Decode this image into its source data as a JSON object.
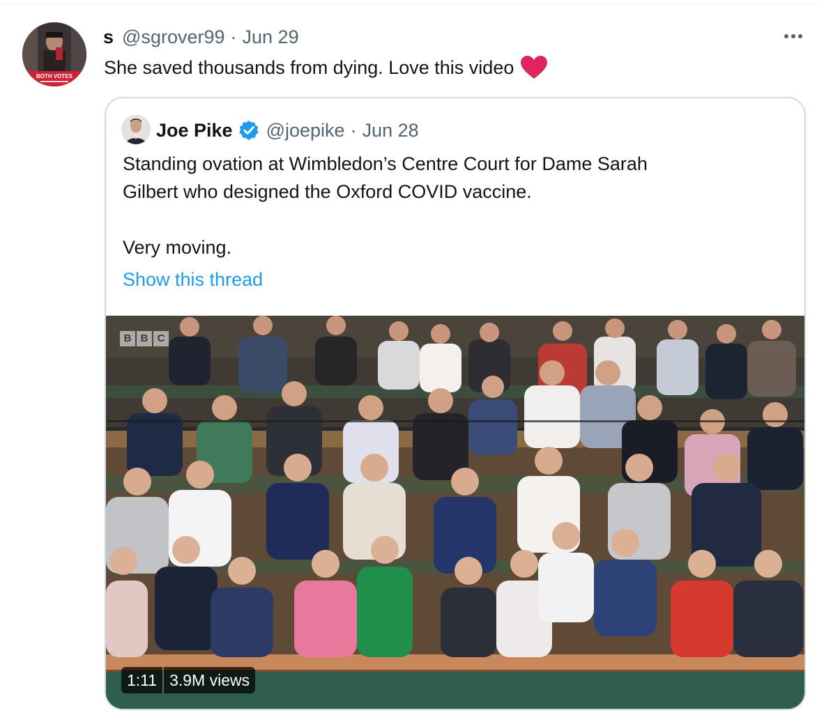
{
  "tweet": {
    "author": {
      "display_name": "s",
      "handle": "@sgrover99",
      "avatar_badge_text": "BOTH VOTES"
    },
    "separator": "·",
    "date": "Jun 29",
    "text": "She saved thousands from dying. Love this video",
    "emoji_icon": "red-heart-icon",
    "more_icon": "more-options-icon"
  },
  "quoted_tweet": {
    "author": {
      "display_name": "Joe Pike",
      "handle": "@joepike",
      "verified": true
    },
    "separator": "·",
    "date": "Jun 28",
    "text_lines": [
      "Standing ovation at Wimbledon’s Centre Court for Dame Sarah",
      "Gilbert who designed the Oxford COVID vaccine.",
      "Very moving."
    ],
    "show_thread_label": "Show this thread",
    "video": {
      "channel_logo": [
        "B",
        "B",
        "C"
      ],
      "duration": "1:11",
      "views": "3.9M views"
    }
  },
  "colors": {
    "text_primary": "#0f1419",
    "text_secondary": "#536471",
    "link": "#1d9bf0",
    "border": "#cfd9de",
    "heart": "#e0245e",
    "verified": "#1d9bf0"
  }
}
